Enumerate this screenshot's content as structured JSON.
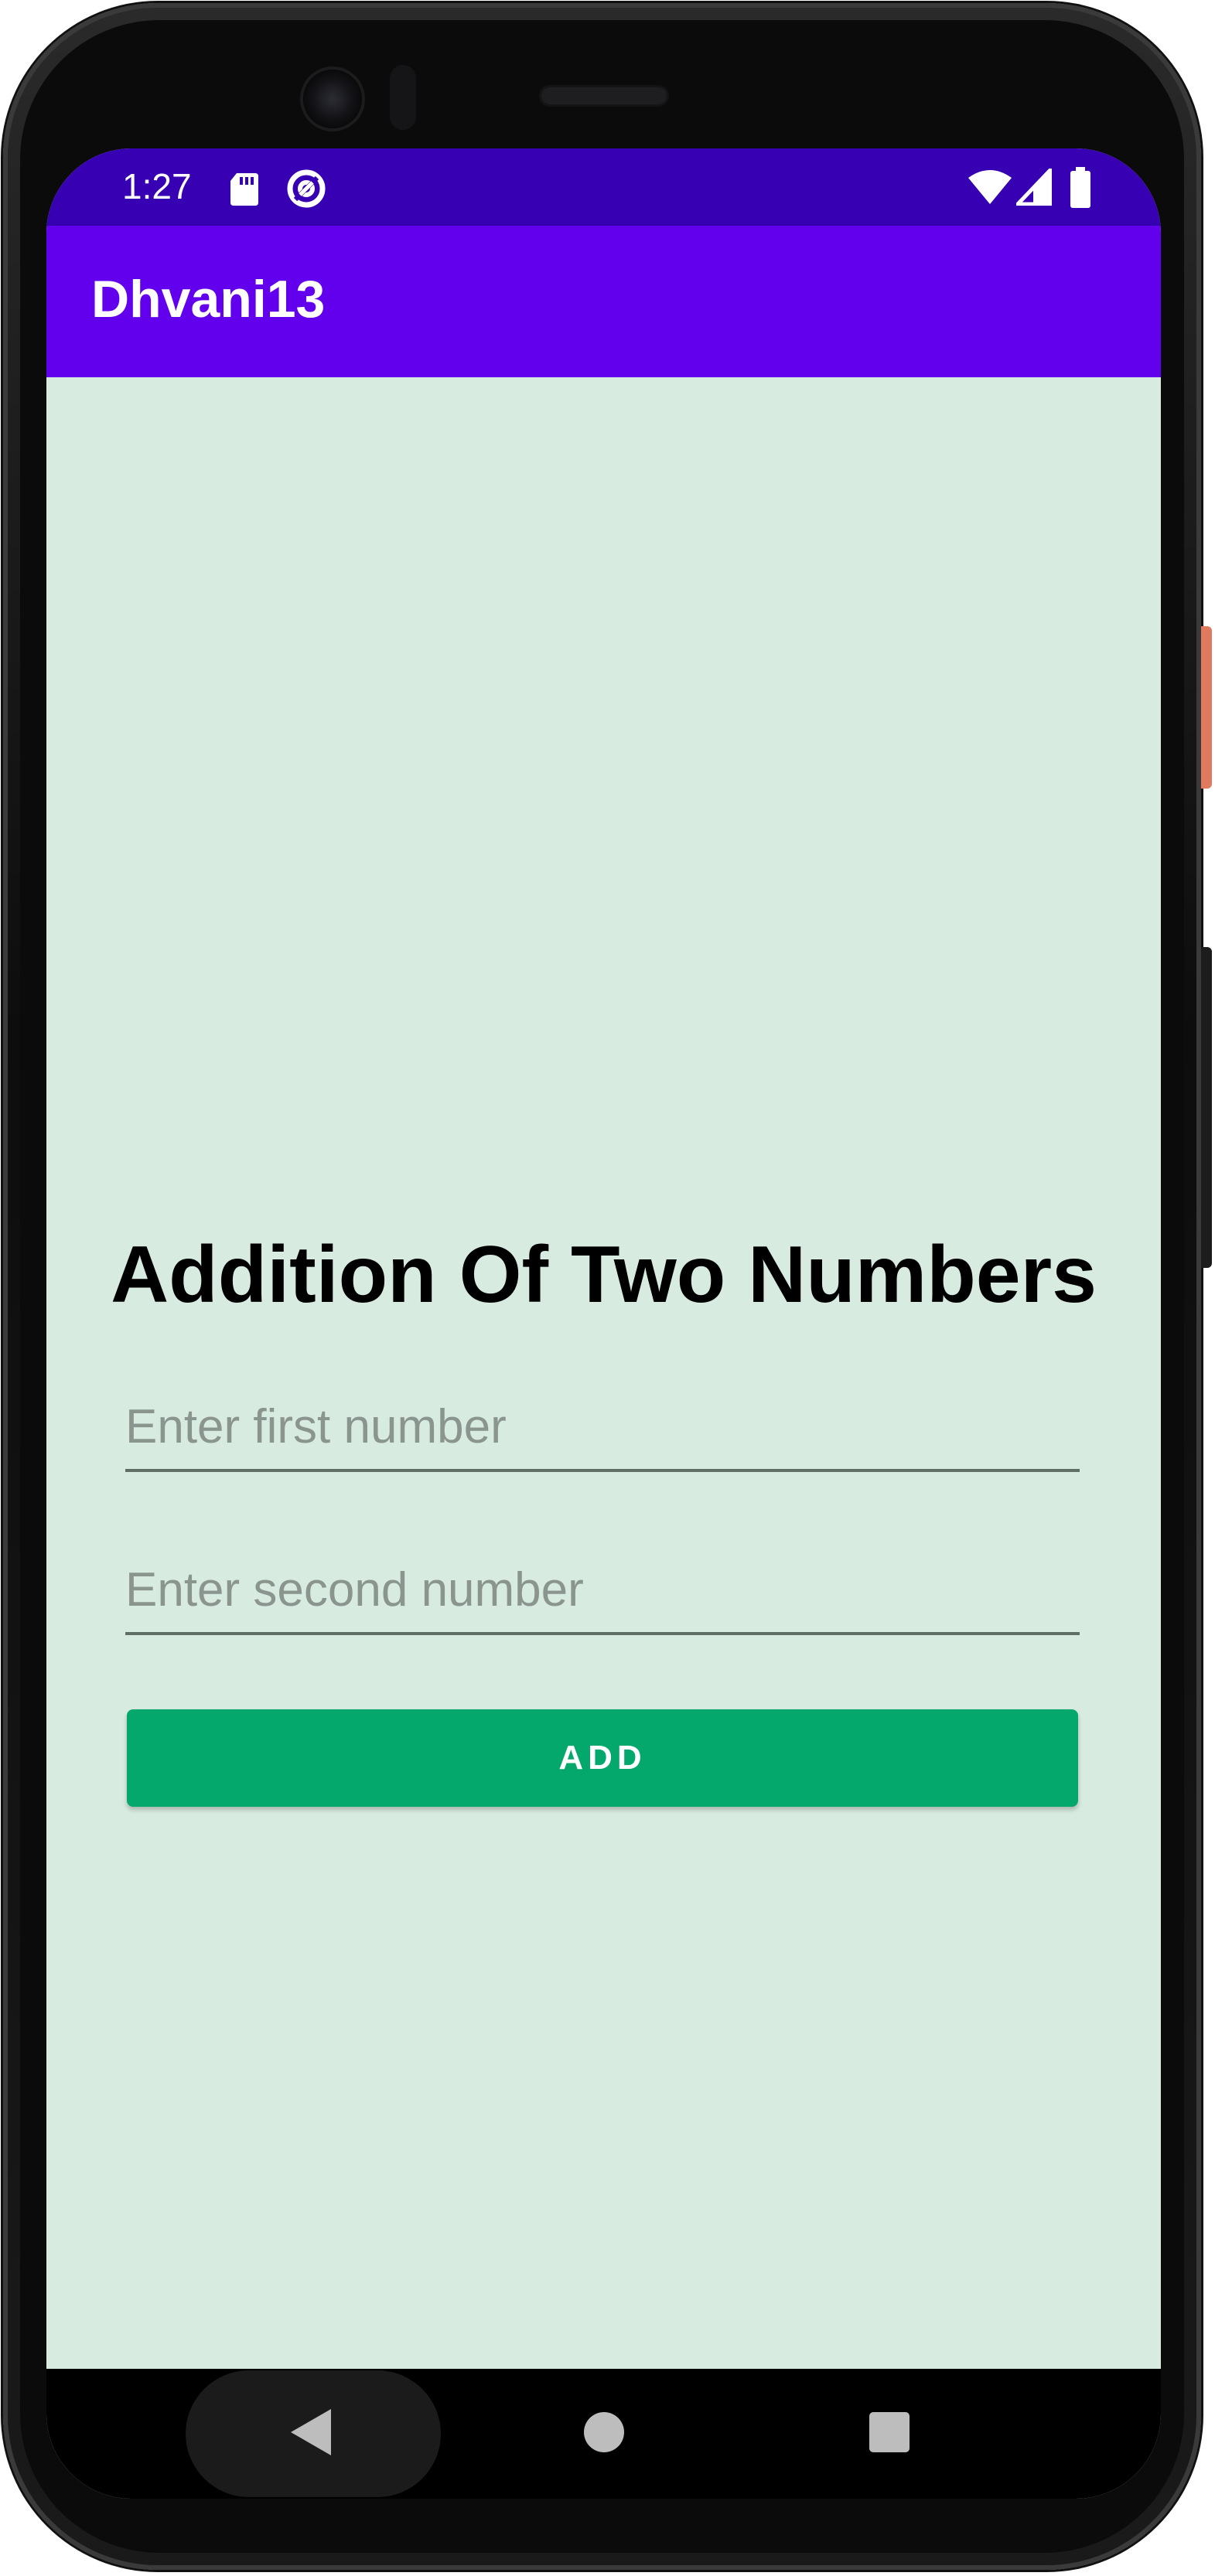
{
  "status_bar": {
    "time": "1:27",
    "left_icons": [
      "sd-card-icon",
      "data-saver-icon"
    ],
    "right_icons": [
      "wifi-icon",
      "cell-signal-icon",
      "battery-icon"
    ]
  },
  "app_bar": {
    "title": "Dhvani13"
  },
  "main": {
    "heading": "Addition Of Two Numbers",
    "first_input": {
      "value": "",
      "placeholder": "Enter first number"
    },
    "second_input": {
      "value": "",
      "placeholder": "Enter second number"
    },
    "add_button_label": "ADD"
  },
  "navigation_bar": {
    "icons": [
      "back-icon",
      "home-icon",
      "recents-icon"
    ]
  },
  "colors": {
    "status_bar": "#3700b3",
    "app_bar": "#6200ee",
    "background": "#d8ebe0",
    "button": "#04a86c"
  }
}
